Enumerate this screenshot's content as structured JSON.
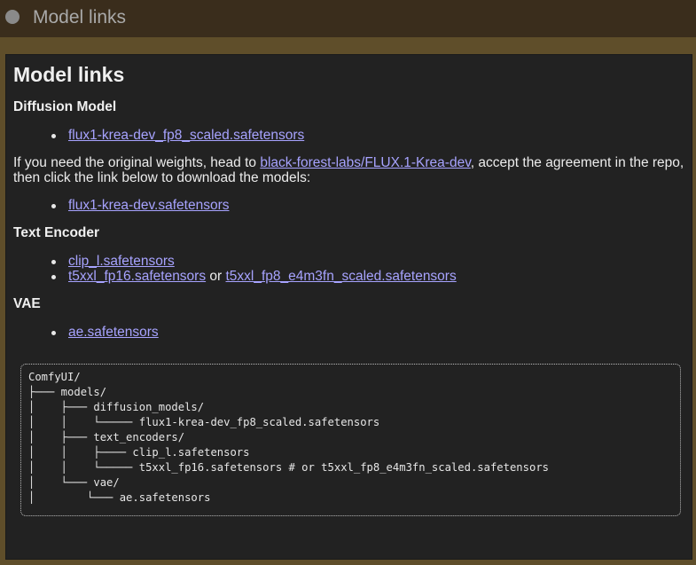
{
  "node": {
    "title": "Model links"
  },
  "doc": {
    "heading": "Model links",
    "diffusion": {
      "heading": "Diffusion Model",
      "link1": "flux1-krea-dev_fp8_scaled.safetensors",
      "para_before": "If you need the original weights, head to ",
      "para_link": "black-forest-labs/FLUX.1-Krea-dev",
      "para_after": ", accept the agreement in the repo, then click the link below to download the models:",
      "link2": "flux1-krea-dev.safetensors"
    },
    "text_encoder": {
      "heading": "Text Encoder",
      "link1": "clip_l.safetensors",
      "link2": "t5xxl_fp16.safetensors",
      "or_text": " or ",
      "link3": "t5xxl_fp8_e4m3fn_scaled.safetensors"
    },
    "vae": {
      "heading": "VAE",
      "link1": "ae.safetensors"
    },
    "code_tree": "ComfyUI/\n├─── models/\n│    ├─── diffusion_models/\n│    │    └───── flux1-krea-dev_fp8_scaled.safetensors\n│    ├─── text_encoders/\n│    │    ├──── clip_l.safetensors\n│    │    └───── t5xxl_fp16.safetensors # or t5xxl_fp8_e4m3fn_scaled.safetensors\n│    └─── vae/\n│        └─── ae.safetensors"
  }
}
